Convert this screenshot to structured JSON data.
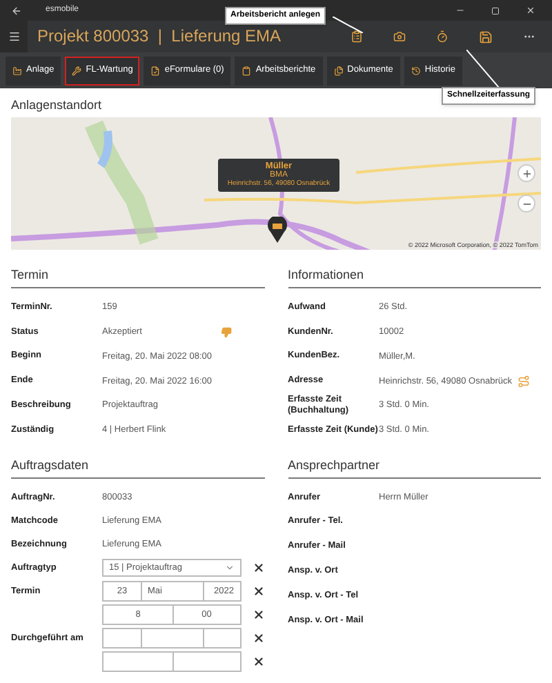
{
  "window": {
    "app_name": "esmobile"
  },
  "header": {
    "title": "Projekt 800033  |  Lieferung EMA"
  },
  "tooltips": [
    {
      "text": "Arbeitsbericht anlegen"
    },
    {
      "text": "Schnellzeiterfassung"
    }
  ],
  "tabs": [
    {
      "label": "Anlage",
      "selected": false
    },
    {
      "label": "FL-Wartung",
      "selected": true
    },
    {
      "label": "eFormulare (0)",
      "selected": false
    },
    {
      "label": "Arbeitsberichte",
      "selected": false
    },
    {
      "label": "Dokumente",
      "selected": false
    },
    {
      "label": "Historie",
      "selected": false
    }
  ],
  "location": {
    "heading": "Anlagenstandort",
    "popup": {
      "name": "Müller",
      "type": "BMA",
      "address": "Heinrichstr. 56, 49080 Osnabrück"
    },
    "copyright": "© 2022 Microsoft Corporation, © 2022 TomTom"
  },
  "termin": {
    "heading": "Termin",
    "rows": [
      {
        "label": "TerminNr.",
        "value": "159",
        "kind": "text"
      },
      {
        "label": "Status",
        "value": "Akzeptiert",
        "kind": "status"
      },
      {
        "label": "Beginn",
        "value": "Freitag, 20. Mai 2022 08:00",
        "kind": "text"
      },
      {
        "label": "Ende",
        "value": "Freitag, 20. Mai 2022 16:00",
        "kind": "text"
      },
      {
        "label": "Beschreibung",
        "value": "Projektauftrag",
        "kind": "text"
      },
      {
        "label": "Zuständig",
        "value": "4  |  Herbert Flink",
        "kind": "text"
      }
    ]
  },
  "informationen": {
    "heading": "Informationen",
    "rows": [
      {
        "label": "Aufwand",
        "value": "26 Std.",
        "kind": "text"
      },
      {
        "label": "KundenNr.",
        "value": "10002",
        "kind": "text"
      },
      {
        "label": "KundenBez.",
        "value": "Müller,M.",
        "kind": "text"
      },
      {
        "label": "Adresse",
        "value": "Heinrichstr. 56, 49080 Osnabrück",
        "kind": "route"
      },
      {
        "label": "Erfasste Zeit (Buchhaltung)",
        "value": "3 Std. 0 Min.",
        "kind": "text"
      },
      {
        "label": "Erfasste Zeit (Kunde)",
        "value": "3 Std. 0 Min.",
        "kind": "text"
      }
    ]
  },
  "auftragsdaten": {
    "heading": "Auftragsdaten",
    "rows": [
      {
        "label": "AuftragNr.",
        "kind": "text",
        "value": "800033"
      },
      {
        "label": "Matchcode",
        "kind": "text",
        "value": "Lieferung EMA"
      },
      {
        "label": "Bezeichnung",
        "kind": "text",
        "value": "Lieferung EMA"
      },
      {
        "label": "Auftragtyp",
        "kind": "select",
        "value": "15  |  Projektauftrag"
      },
      {
        "label": "Termin",
        "kind": "date",
        "parts": [
          "23",
          "Mai",
          "2022"
        ]
      },
      {
        "kind": "time",
        "parts": [
          "8",
          "00"
        ]
      },
      {
        "label": "Durchgeführt am",
        "kind": "date"
      },
      {
        "kind": "time"
      }
    ]
  },
  "ansprechpartner": {
    "heading": "Ansprechpartner",
    "rows": [
      {
        "label": "Anrufer",
        "value": "Herrn Müller"
      },
      {
        "label": "Anrufer - Tel."
      },
      {
        "label": "Anrufer - Mail"
      },
      {
        "label": "Ansp. v. Ort"
      },
      {
        "label": "Ansp. v. Ort - Tel"
      },
      {
        "label": "Ansp. v. Ort - Mail"
      }
    ]
  }
}
